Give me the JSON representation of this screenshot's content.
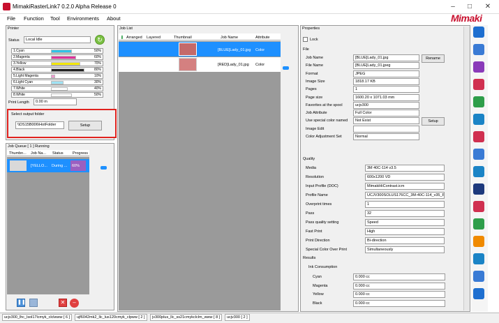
{
  "window": {
    "title": "MimakiRasterLink7 0.2.0 Alpha Release 0"
  },
  "menu": [
    "File",
    "Function",
    "Tool",
    "Environments",
    "About"
  ],
  "logo": "Mimaki",
  "printer": {
    "section_label": "Printer",
    "status_label": "Status",
    "status_value": "Local Idle",
    "inks": [
      {
        "name": "1.Cyan",
        "percent": "50%",
        "level": 0.5,
        "color": "#2fc3e8"
      },
      {
        "name": "2.Magenta",
        "percent": "60%",
        "level": 0.6,
        "color": "#e0309a"
      },
      {
        "name": "3.Yellow",
        "percent": "70%",
        "level": 0.7,
        "color": "#f2e600"
      },
      {
        "name": "4.Black",
        "percent": "80%",
        "level": 0.8,
        "color": "#222222"
      },
      {
        "name": "5.Light Magenta",
        "percent": "10%",
        "level": 0.1,
        "color": "#f29ad0"
      },
      {
        "name": "6.Light Cyan",
        "percent": "30%",
        "level": 0.3,
        "color": "#9de3f5"
      },
      {
        "name": "7.White",
        "percent": "40%",
        "level": 0.4,
        "color": "#ffffff"
      },
      {
        "name": "8.White",
        "percent": "50%",
        "level": 0.5,
        "color": "#ffffff"
      }
    ],
    "print_length_label": "Print Length",
    "print_length_value": "0.00 m",
    "output_folder_label": "Select output folder",
    "output_folder_value": "\\\\DS15B006\\HotFolder",
    "setup_label": "Setup"
  },
  "job_queue": {
    "label": "Job Queue [ 1 ] Running",
    "columns": [
      "Thumbn...",
      "Job Na...",
      "Status",
      "Progress"
    ],
    "rows": [
      {
        "name": "[YELLO...",
        "status": "During ...",
        "progress": "60%"
      }
    ]
  },
  "job_list": {
    "label": "Job List",
    "columns": [
      "Arranged",
      "Layered",
      "Thumbnail",
      "Job Name",
      "Attribute"
    ],
    "rows": [
      {
        "name": "[BLUE]Lady_01.jpg",
        "attribute": "Color",
        "selected": true
      },
      {
        "name": "[RED]Lady_01.jpg",
        "attribute": "Color",
        "selected": false
      }
    ]
  },
  "properties": {
    "label": "Properties",
    "lock_label": "Lock",
    "file_section": "File",
    "file": [
      {
        "label": "Job Name",
        "value": "[BLUE]Lady_01.jpg"
      },
      {
        "label": "File Name",
        "value": "[BLUE]Lady_01.jpeg"
      },
      {
        "label": "Format",
        "value": "JPEG"
      },
      {
        "label": "Image Size",
        "value": "1818.17 KB"
      },
      {
        "label": "Pages",
        "value": "1"
      },
      {
        "label": "Page size",
        "value": "1600.20 x 1071.03 mm"
      },
      {
        "label": "Favorites at the spool",
        "value": "ucjv300"
      },
      {
        "label": "Job Attribute",
        "value": "Full Color"
      },
      {
        "label": "Use special color named",
        "value": "Not Exist"
      },
      {
        "label": "Image Edit",
        "value": ""
      },
      {
        "label": "Color Adjustment Set",
        "value": "Normal"
      }
    ],
    "rename_label": "Rename",
    "setup_label": "Setup",
    "quality_section": "Quality",
    "quality": [
      {
        "label": "Media",
        "value": "3M 40C-114 v3.5"
      },
      {
        "label": "Resolution",
        "value": "600x1200 VD"
      },
      {
        "label": "Input Profile (DOC)",
        "value": "MimakiHiContrast.icm"
      },
      {
        "label": "Profile Name",
        "value": "UCJV300SOLUS176CC_3M-40C-114_v35_F"
      },
      {
        "label": "Overprint times",
        "value": "1"
      },
      {
        "label": "Pass",
        "value": "32"
      },
      {
        "label": "Pass quality setting",
        "value": "Speed"
      },
      {
        "label": "Fast Print",
        "value": "High"
      },
      {
        "label": "Print Direction",
        "value": "Bi-direction"
      },
      {
        "label": "Special Color Over Print",
        "value": "Simultaneously"
      }
    ],
    "results_section": "Results",
    "ink_consumption_label": "Ink Consumption",
    "results": [
      {
        "label": "Cyan",
        "value": "0.000 cc"
      },
      {
        "label": "Magenta",
        "value": "0.000 cc"
      },
      {
        "label": "Yellow",
        "value": "0.000 cc"
      },
      {
        "label": "Black",
        "value": "0.000 cc"
      }
    ]
  },
  "status_tabs": [
    "ucjv300_lhc_lsol17lcmyk_clclwww [ 6 ]",
    "ujf6042mk2_llc_lus120cmyk_clpww [ 2 ]",
    "jv300plus_llc_ss21cmykclclm_www [ 8 ]",
    "ucjv300 [ 2 ]"
  ],
  "side_icons": [
    {
      "name": "info-icon",
      "color": "#1e6fd0"
    },
    {
      "name": "document-settings-icon",
      "color": "#3a7bd5"
    },
    {
      "name": "search-q-icon",
      "color": "#8a3ab9"
    },
    {
      "name": "layout-icon",
      "color": "#d03050"
    },
    {
      "name": "color-replace-icon",
      "color": "#2e9e4a"
    },
    {
      "name": "print-icon",
      "color": "#1b84c6"
    },
    {
      "name": "cut-icon",
      "color": "#d03050"
    },
    {
      "name": "grid-icon",
      "color": "#3a7bd5"
    },
    {
      "name": "go-icon",
      "color": "#1b84c6"
    },
    {
      "name": "star-layout-icon",
      "color": "#1e3a7d"
    },
    {
      "name": "color-collection-icon",
      "color": "#d03050"
    },
    {
      "name": "recycle-icon",
      "color": "#2e9e4a"
    },
    {
      "name": "star-icon",
      "color": "#f08a00"
    },
    {
      "name": "copy-icon",
      "color": "#1b84c6"
    },
    {
      "name": "trash-icon",
      "color": "#3a7bd5"
    },
    {
      "name": "help-icon",
      "color": "#1e6fd0"
    }
  ]
}
